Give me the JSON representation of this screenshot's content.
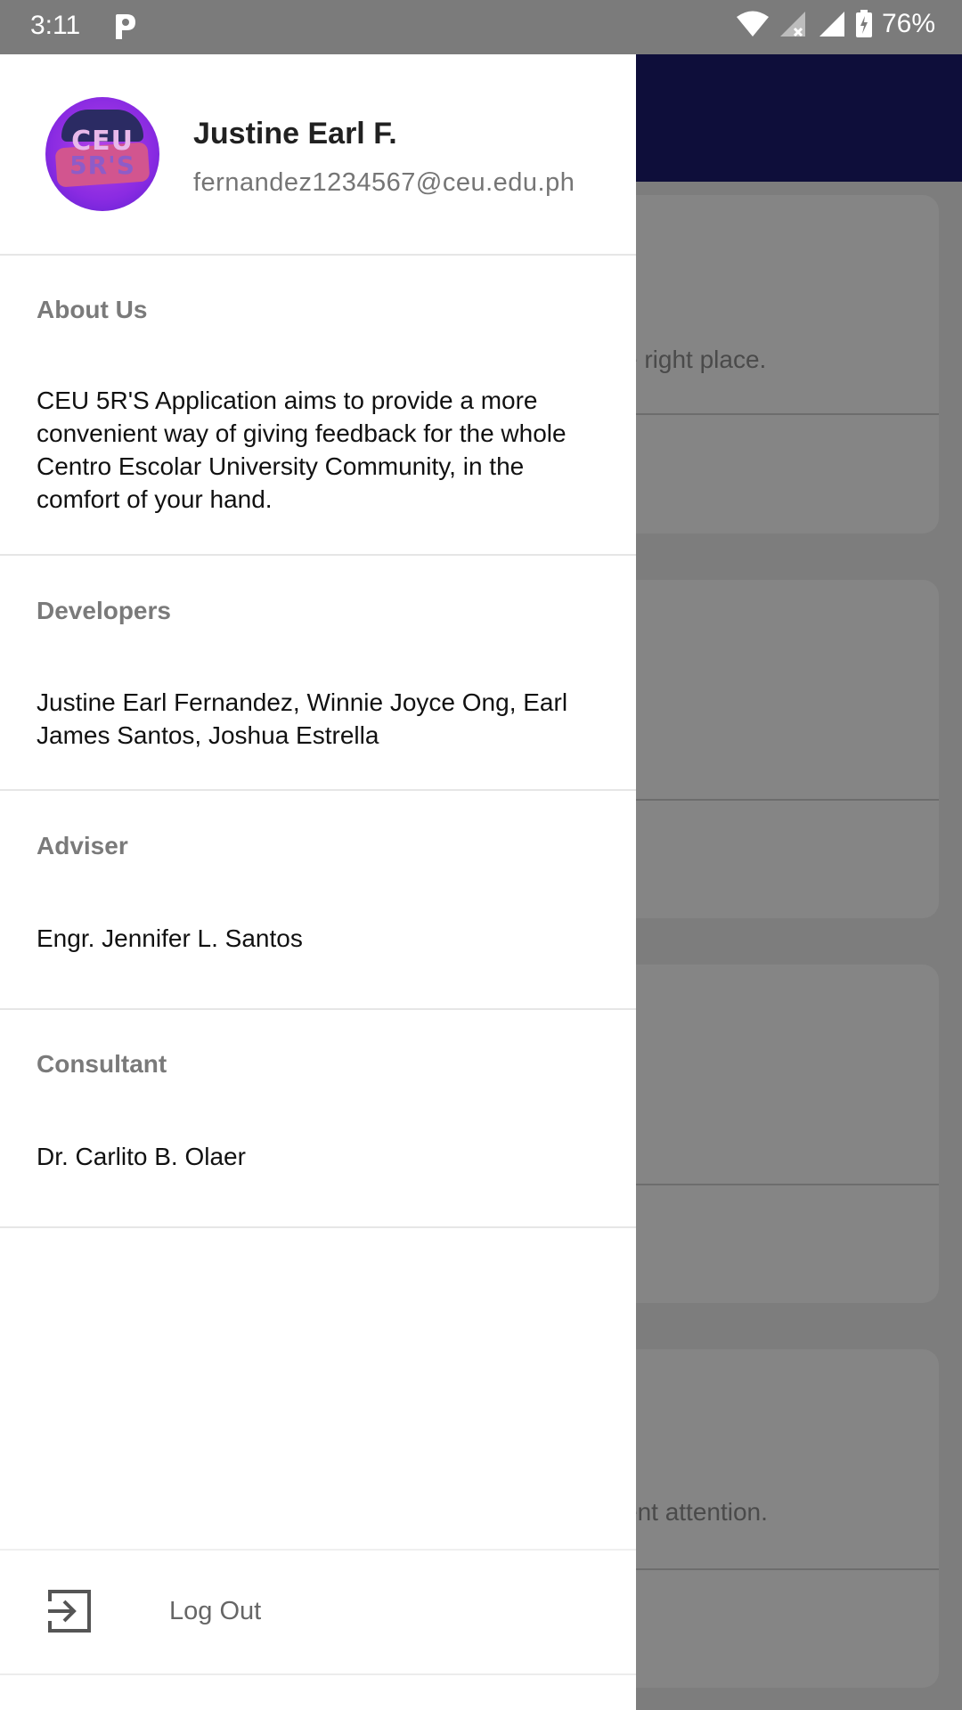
{
  "status_bar": {
    "time": "3:11",
    "battery_percent": "76%",
    "icons": [
      "p-app-icon",
      "wifi-icon",
      "signal-no-sim-icon",
      "signal-icon",
      "battery-charging-icon"
    ]
  },
  "background": {
    "text_1": "e right place.",
    "text_2": "ent attention."
  },
  "drawer": {
    "avatar": {
      "logo_text_1": "CEU",
      "logo_text_2": "5R'S"
    },
    "user": {
      "name": "Justine Earl F.",
      "email": "fernandez1234567@ceu.edu.ph"
    },
    "sections": {
      "about": {
        "title": "About Us",
        "body": "CEU 5R'S Application aims to provide a more convenient way of giving feedback for the whole Centro Escolar University Community, in the comfort of your hand."
      },
      "developers": {
        "title": "Developers",
        "body": "Justine Earl Fernandez, Winnie Joyce Ong, Earl James Santos, Joshua Estrella"
      },
      "adviser": {
        "title": "Adviser",
        "body": "Engr. Jennifer L. Santos"
      },
      "consultant": {
        "title": "Consultant",
        "body": "Dr. Carlito B. Olaer"
      }
    },
    "logout": {
      "label": "Log Out",
      "icon": "logout-icon"
    }
  },
  "colors": {
    "toolbar": "#0e0e3a",
    "scrim": "#7d7d7d",
    "drawer_bg": "#ffffff",
    "section_title": "#7a7a7a"
  }
}
